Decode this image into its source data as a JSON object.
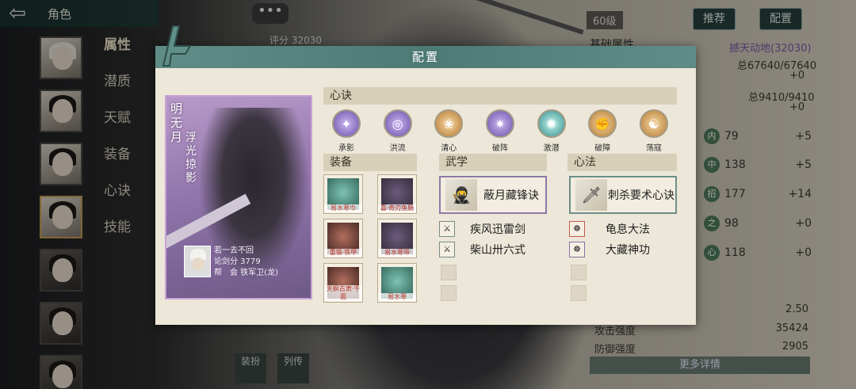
{
  "header": {
    "back_icon": "back-arrow-icon",
    "title": "角色"
  },
  "sidebar_menu": [
    {
      "label": "属性"
    },
    {
      "label": "潜质"
    },
    {
      "label": "天赋"
    },
    {
      "label": "装备"
    },
    {
      "label": "心诀"
    },
    {
      "label": "技能"
    }
  ],
  "top_right": {
    "recommend_label": "推荐",
    "config_label": "配置",
    "level": "60级",
    "chat_label": "•••"
  },
  "background_panel": {
    "score": "评分  32030",
    "base_attr_title": "基础属性",
    "sect_name": "撼天动地(32030)",
    "hp": "总67640/67640",
    "hp_add": "+0",
    "mp": "总9410/9410",
    "mp_add": "+0",
    "stats": [
      {
        "icon": "内",
        "value": "79",
        "add": "+5"
      },
      {
        "icon": "中",
        "value": "138",
        "add": "+5"
      },
      {
        "icon": "招",
        "value": "177",
        "add": "+14"
      },
      {
        "icon": "之",
        "value": "98",
        "add": "+0"
      },
      {
        "icon": "心",
        "value": "118",
        "add": "+0"
      }
    ],
    "rate_value": "2.50",
    "attack_label": "攻击强度",
    "attack_value": "35424",
    "defense_label": "防御强度",
    "defense_value": "2905",
    "more_label": "更多详情",
    "bottom_btn1": "装扮",
    "bottom_btn2": "列传"
  },
  "modal": {
    "title": "配置",
    "card": {
      "name_line1": "明无月",
      "name_line2": "浮光掠影",
      "sub_name": "若一去不回",
      "sword_score": "论剑分 3779",
      "guild": "帮　会 铁军卫(龙)"
    },
    "xinjue_label": "心诀",
    "xinjue_skills": [
      {
        "name": "承影",
        "style": "p",
        "icon": "swirl-purple-icon"
      },
      {
        "name": "洪流",
        "style": "p",
        "icon": "whirlpool-icon"
      },
      {
        "name": "清心",
        "style": "o",
        "icon": "lotus-icon"
      },
      {
        "name": "破阵",
        "style": "p",
        "icon": "formation-break-icon"
      },
      {
        "name": "激潜",
        "style": "t",
        "icon": "burst-icon"
      },
      {
        "name": "破障",
        "style": "o",
        "icon": "fist-icon"
      },
      {
        "name": "荡寇",
        "style": "o",
        "icon": "sweep-icon"
      }
    ],
    "equip_label": "装备",
    "equipment": [
      {
        "caption": "易水寒巾",
        "style": "g"
      },
      {
        "caption": "嘉·奇刃鱼肠",
        "style": ""
      },
      {
        "caption": "重锻·铁甲",
        "style": "r"
      },
      {
        "caption": "易水寒带",
        "style": ""
      },
      {
        "caption": "天枫古肃·千面",
        "style": "r"
      },
      {
        "caption": "易水寒",
        "style": "g"
      }
    ],
    "wuxue_label": "武学",
    "wuxue_main": "蔽月藏锋诀",
    "wuxue_list": [
      "疾风迅雷剑",
      "柴山卅六式"
    ],
    "xinfa_label": "心法",
    "xinfa_main": "刺杀要术心诀",
    "xinfa_list": [
      "龟息大法",
      "大藏神功"
    ]
  }
}
